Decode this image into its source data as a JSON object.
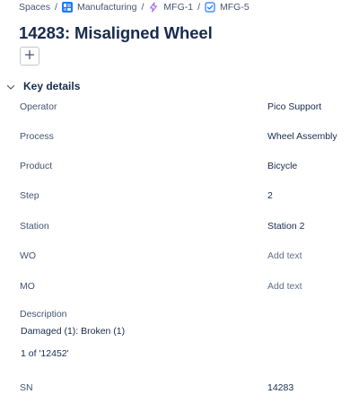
{
  "breadcrumb": {
    "spaces": "Spaces",
    "project": "Manufacturing",
    "parent": "MFG-1",
    "issue": "MFG-5",
    "separator": "/"
  },
  "issue": {
    "title": "14283: Misaligned Wheel"
  },
  "icons": {
    "project": "project-grid-icon",
    "parent": "epic-lightning-icon",
    "issue": "task-checkbox-icon",
    "add": "plus-icon",
    "section": "chevron-down-icon"
  },
  "colors": {
    "project_icon": "#1d7afc",
    "epic_icon": "#a66ae6",
    "task_icon": "#1d7afc"
  },
  "key_details": {
    "title": "Key details",
    "fields": {
      "operator": {
        "label": "Operator",
        "value": "Pico Support"
      },
      "process": {
        "label": "Process",
        "value": "Wheel Assembly"
      },
      "product": {
        "label": "Product",
        "value": "Bicycle"
      },
      "step": {
        "label": "Step",
        "value": "2"
      },
      "station": {
        "label": "Station",
        "value": "Station 2"
      },
      "wo": {
        "label": "WO",
        "placeholder": "Add text"
      },
      "mo": {
        "label": "MO",
        "placeholder": "Add text"
      },
      "sn": {
        "label": "SN",
        "value": "14283"
      }
    },
    "description": {
      "label": "Description",
      "line1": "Damaged (1): Broken (1)",
      "line2": "1 of '12452'"
    }
  }
}
